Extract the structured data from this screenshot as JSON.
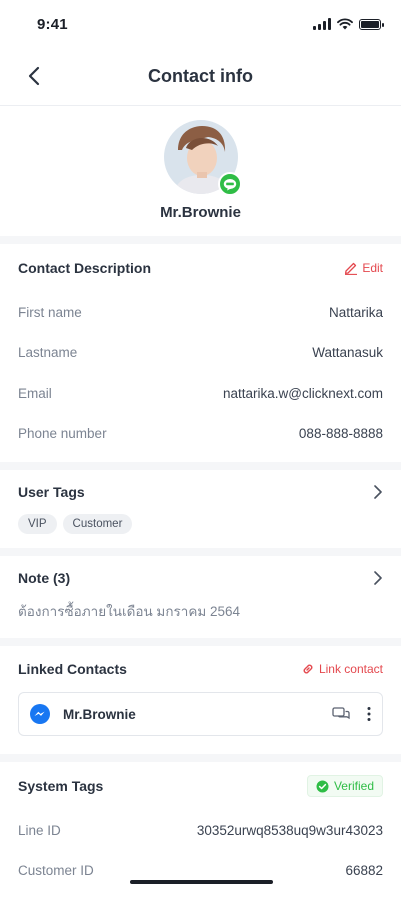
{
  "status_bar": {
    "time": "9:41"
  },
  "nav": {
    "title": "Contact info"
  },
  "profile": {
    "name": "Mr.Brownie"
  },
  "contact_description": {
    "title": "Contact Description",
    "edit_label": "Edit",
    "fields": [
      {
        "label": "First name",
        "value": "Nattarika"
      },
      {
        "label": "Lastname",
        "value": "Wattanasuk"
      },
      {
        "label": "Email",
        "value": "nattarika.w@clicknext.com"
      },
      {
        "label": "Phone number",
        "value": "088-888-8888"
      }
    ]
  },
  "user_tags": {
    "title": "User Tags",
    "tags": [
      "VIP",
      "Customer"
    ]
  },
  "note": {
    "title": "Note (3)",
    "text": "ต้องการซื้อภายในเดือน มกราคม 2564"
  },
  "linked_contacts": {
    "title": "Linked Contacts",
    "link_label": "Link contact",
    "contact_name": "Mr.Brownie"
  },
  "system_tags": {
    "title": "System Tags",
    "verified_label": "Verified",
    "fields": [
      {
        "label": "Line ID",
        "value": "30352urwq8538uq9w3ur43023"
      },
      {
        "label": "Customer ID",
        "value": "66882"
      }
    ]
  },
  "colors": {
    "accent_red": "#e4484e",
    "line_green": "#2fbd46",
    "messenger_blue": "#1877f2"
  },
  "icons": [
    "back-chevron-icon",
    "line-app-icon",
    "edit-pencil-icon",
    "chevron-right-icon",
    "link-icon",
    "messenger-icon",
    "chat-bubbles-icon",
    "more-vertical-icon",
    "check-circle-icon"
  ]
}
